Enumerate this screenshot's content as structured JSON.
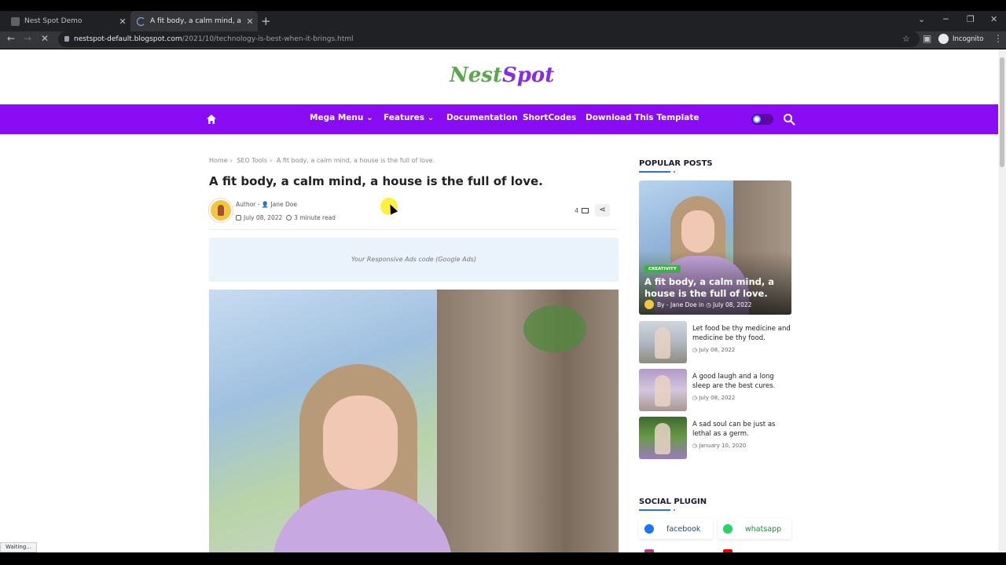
{
  "browser": {
    "tabs": [
      {
        "title": "Nest Spot Demo",
        "active": false
      },
      {
        "title": "A fit body, a calm mind, a house",
        "active": true
      }
    ],
    "url_host": "nestspot-default.blogspot.com",
    "url_path": "/2021/10/technology-is-best-when-it-brings.html",
    "incognito_label": "Incognito",
    "status_text": "Waiting..."
  },
  "site": {
    "logo_part1": "Nest",
    "logo_part2": "Spot",
    "brand_color": "#8a0cf2"
  },
  "nav": {
    "items": [
      {
        "label": "Mega Menu",
        "dropdown": true
      },
      {
        "label": "Features",
        "dropdown": true
      },
      {
        "label": "Documentation",
        "dropdown": false
      },
      {
        "label": "ShortCodes",
        "dropdown": false
      },
      {
        "label": "Download This Template",
        "dropdown": false
      }
    ]
  },
  "post": {
    "breadcrumb": [
      "Home",
      "SEO Tools",
      "A fit body, a calm mind, a house is the full of love."
    ],
    "title": "A fit body, a calm mind, a house is the full of love.",
    "author_prefix": "Author -",
    "author_name": "Jane Doe",
    "date": "July 08, 2022",
    "read_time": "3 minute read",
    "comment_count": "4",
    "ads_text": "Your Responsive Ads code (Google Ads)"
  },
  "sidebar": {
    "popular_heading": "POPULAR POSTS",
    "featured": {
      "category": "CREATIVITY",
      "title": "A fit body, a calm mind, a house is the full of love.",
      "byline": "By - Jane Doe in",
      "date": "July 08, 2022"
    },
    "posts": [
      {
        "title": "Let food be thy medicine and medicine be thy food.",
        "date": "July 08, 2022"
      },
      {
        "title": "A good laugh and a long sleep are the best cures.",
        "date": "July 08, 2022"
      },
      {
        "title": "A sad soul can be just as lethal as a germ.",
        "date": "January 10, 2020"
      }
    ],
    "social_heading": "SOCIAL PLUGIN",
    "social": [
      {
        "label": "facebook",
        "color": "#1877f2"
      },
      {
        "label": "whatsapp",
        "color": "#25d366"
      }
    ]
  }
}
